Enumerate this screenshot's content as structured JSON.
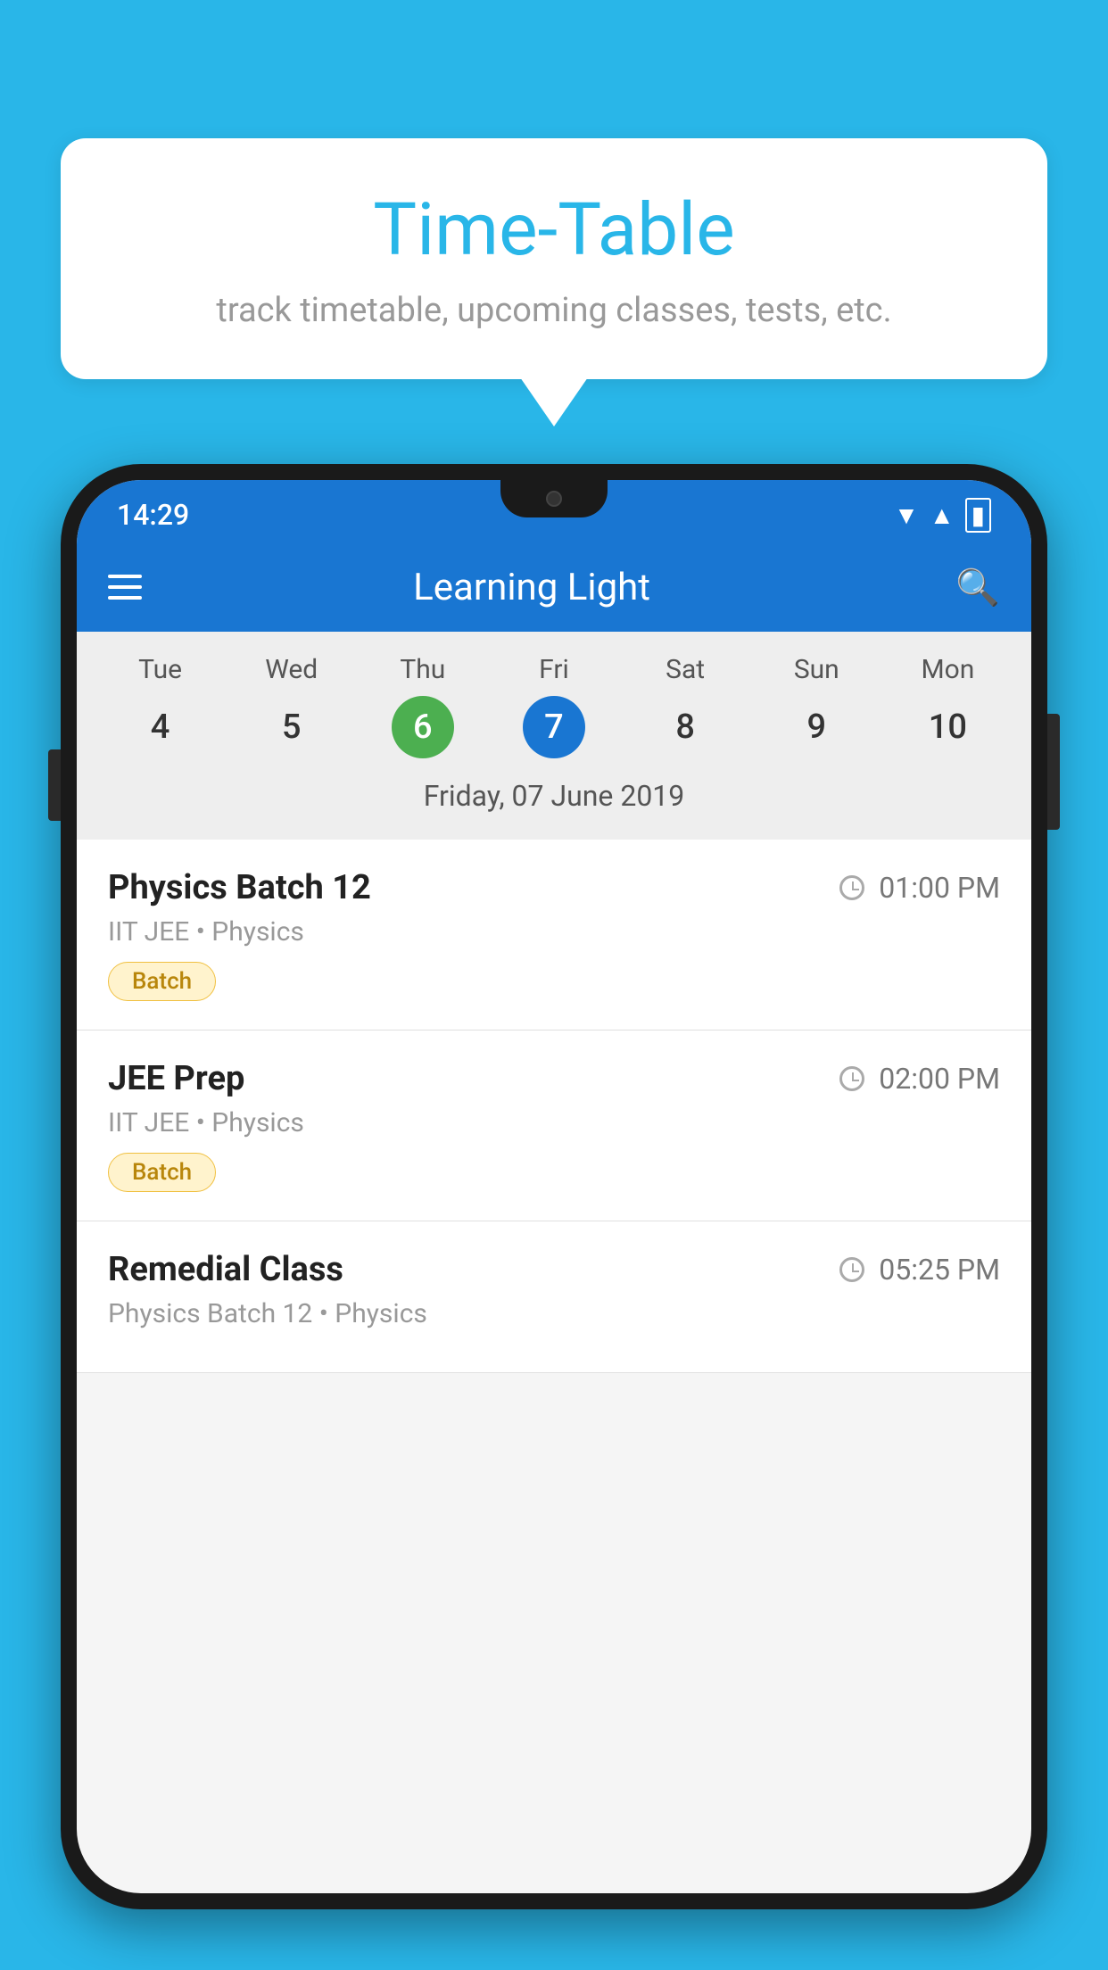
{
  "background_color": "#29b6e8",
  "speech_bubble": {
    "title": "Time-Table",
    "subtitle": "track timetable, upcoming classes, tests, etc."
  },
  "status_bar": {
    "time": "14:29"
  },
  "app_bar": {
    "title": "Learning Light"
  },
  "calendar": {
    "days": [
      {
        "label": "Tue",
        "number": "4"
      },
      {
        "label": "Wed",
        "number": "5"
      },
      {
        "label": "Thu",
        "number": "6",
        "state": "today"
      },
      {
        "label": "Fri",
        "number": "7",
        "state": "selected"
      },
      {
        "label": "Sat",
        "number": "8"
      },
      {
        "label": "Sun",
        "number": "9"
      },
      {
        "label": "Mon",
        "number": "10"
      }
    ],
    "selected_date_label": "Friday, 07 June 2019"
  },
  "schedule": {
    "items": [
      {
        "title": "Physics Batch 12",
        "time": "01:00 PM",
        "subtitle": "IIT JEE • Physics",
        "badge": "Batch"
      },
      {
        "title": "JEE Prep",
        "time": "02:00 PM",
        "subtitle": "IIT JEE • Physics",
        "badge": "Batch"
      },
      {
        "title": "Remedial Class",
        "time": "05:25 PM",
        "subtitle": "Physics Batch 12 • Physics",
        "badge": null
      }
    ]
  }
}
